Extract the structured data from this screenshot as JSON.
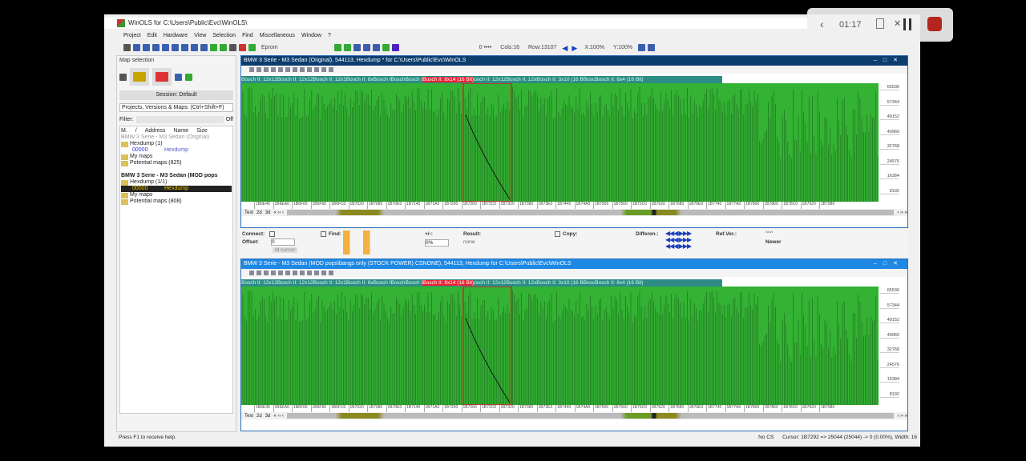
{
  "app": {
    "title": "WinOLS for C:\\Users\\Public\\Evc\\WinOLS\\"
  },
  "menu": [
    "Project",
    "Edit",
    "Hardware",
    "View",
    "Selection",
    "Find",
    "Miscellaneous",
    "Window",
    "?"
  ],
  "toolbar": {
    "eprom": "Eprom",
    "value": "0 ••••",
    "cols": "Cols:16",
    "row": "Row:13107",
    "x_zoom": "X:100%",
    "y_zoom": "Y:100%"
  },
  "recorder": {
    "time": "01:17"
  },
  "map_selection": {
    "title": "Map selection",
    "session": "Session: Default",
    "search": "Projects, Versions & Maps: (Ctrl+Shift+F)",
    "filter": "Filter:",
    "filter_off": "Off",
    "columns": [
      "M.",
      "/",
      "Address",
      "Name",
      "Size"
    ],
    "projects": [
      {
        "name": "BMW 3 Serie - M3 Sedan (Original)",
        "items": [
          {
            "label": "Hexdump (1)"
          },
          {
            "address": "00000",
            "name": "Hexdump",
            "selected": false
          },
          {
            "label": "My maps"
          },
          {
            "label": "Potential maps (825)"
          }
        ]
      },
      {
        "name": "BMW 3 Serie - M3 Sedan (MOD pops",
        "items": [
          {
            "label": "Hexdump (1/1)"
          },
          {
            "address": "00000",
            "name": "Hexdump",
            "selected": true
          },
          {
            "label": "My maps"
          },
          {
            "label": "Potential maps (808)"
          }
        ]
      }
    ]
  },
  "windows": [
    {
      "title": "BMW 3 Serie - M3 Sedan (Original), 544113, Hexdump * for C:\\Users\\Public\\Evc\\WinOLS",
      "active": false
    },
    {
      "title": "BMW 3 Serie - M3 Sedan (MOD pops\\bangs only (STOCK POWER) CSNONE), 544113, Hexdump for C:\\Users\\Public\\Evc\\WinOLS",
      "active": true
    }
  ],
  "map_labels": [
    "Bosch II: 12x12",
    "Bosch II: 12x12",
    "Bosch II: 12x1",
    "Bosch II: 8x",
    "Bosch I",
    "Bosch",
    "Bosch I",
    "Bosch II: 8x14 (16 Bit)",
    "osch II: 12x12",
    "Bosch II: 12x",
    "Bosch II: 3x10 (16 B",
    "Bosc",
    "Bosch II: 6x4 (16 Bit)"
  ],
  "highlighted_label": "Bosch II: 8x14 (16 Bit)",
  "y_ticks": [
    "65536",
    "57344",
    "49152",
    "40960",
    "32768",
    "24576",
    "16384",
    "8192"
  ],
  "x_ticks": [
    "1B6E40",
    "1B6EA0",
    "1B6F00",
    "1B6F60",
    "1B6FC0",
    "1B7020",
    "1B7080",
    "1B70E0",
    "1B7140",
    "1B71A0",
    "1B7200",
    "1B7260",
    "1B72C0",
    "1B7320",
    "1B7380",
    "1B73E0",
    "1B7440",
    "1B74A0",
    "1B7500",
    "1B7560",
    "1B75C0",
    "1B7620",
    "1B7680",
    "1B76E0",
    "1B7740",
    "1B77A0",
    "1B7800",
    "1B7860",
    "1B78C0",
    "1B7920",
    "1B7980"
  ],
  "view_tabs": [
    "Text",
    "2d",
    "3d"
  ],
  "mid": {
    "connect": "Connect:",
    "offset": "Offset:",
    "offset_value": "0",
    "m_cursor": "M cursor",
    "find": "Find:",
    "plusminus": "+/-:",
    "percent": "0%",
    "result": "Result:",
    "result_value": "none",
    "copy": "Copy:",
    "differences": "Differen.:",
    "refver": "Ref.Ver.:",
    "newer": "Newer",
    "stars": "^^^"
  },
  "status": {
    "help": "Press F1 to receive help.",
    "cs": "No CS",
    "cursor": "Cursor: 1B7292 => 25044 (25044) ->",
    "percent": "0 (0.00%), Width: 16"
  },
  "colors": {
    "chart_bg": "#33b233",
    "title_inactive": "#0b3d6e",
    "title_active": "#1e88e5",
    "highlight": "#e02020"
  }
}
